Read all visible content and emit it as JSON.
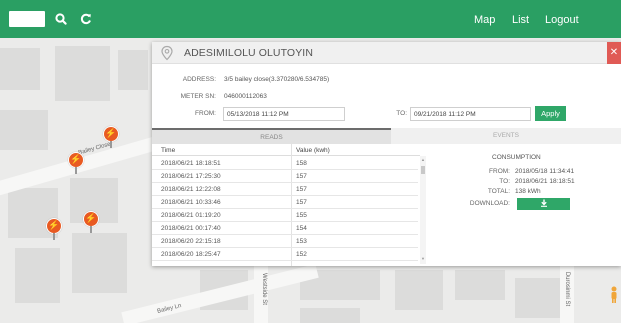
{
  "nav": {
    "map": "Map",
    "list": "List",
    "logout": "Logout"
  },
  "map": {
    "streets": {
      "bailey_close": "Bailey Close",
      "bailey_ln": "Bailey Ln",
      "westside": "Westside St",
      "durosinmi": "Durosinmi St"
    }
  },
  "panel": {
    "title": "ADESIMILOLU OLUTOYIN",
    "address_label": "ADDRESS:",
    "address": "3/5 bailey close(3.370280/6.534785)",
    "meter_label": "METER SN:",
    "meter": "046000112063",
    "from_label": "FROM:",
    "from_value": "05/13/2018 11:12 PM",
    "to_label": "TO:",
    "to_value": "09/21/2018 11:12 PM",
    "apply": "Apply",
    "tabs": {
      "reads": "READS",
      "events": "EVENTS"
    },
    "table": {
      "col_time": "Time",
      "col_value": "Value (kwh)",
      "rows": [
        {
          "time": "2018/06/21 18:18:51",
          "value": "158"
        },
        {
          "time": "2018/06/21 17:25:30",
          "value": "157"
        },
        {
          "time": "2018/06/21 12:22:08",
          "value": "157"
        },
        {
          "time": "2018/06/21 10:33:46",
          "value": "157"
        },
        {
          "time": "2018/06/21 01:19:20",
          "value": "155"
        },
        {
          "time": "2018/06/21 00:17:40",
          "value": "154"
        },
        {
          "time": "2018/06/20 22:15:18",
          "value": "153"
        },
        {
          "time": "2018/06/20 18:25:47",
          "value": "152"
        }
      ]
    },
    "consumption": {
      "title": "CONSUMPTION",
      "from_label": "FROM:",
      "from": "2018/05/18 11:34:41",
      "to_label": "TO:",
      "to": "2018/06/21 18:18:51",
      "total_label": "TOTAL:",
      "total": "138 kWh",
      "download_label": "DOWNLOAD:"
    }
  },
  "colors": {
    "brand": "#2a9f63",
    "accent": "#2fa768",
    "close": "#e05a55",
    "pin": "#e85a22"
  },
  "icons": [
    "search-icon",
    "refresh-icon",
    "location-pin-icon",
    "close-icon",
    "download-icon",
    "meter-marker-icon",
    "pegman-icon"
  ]
}
